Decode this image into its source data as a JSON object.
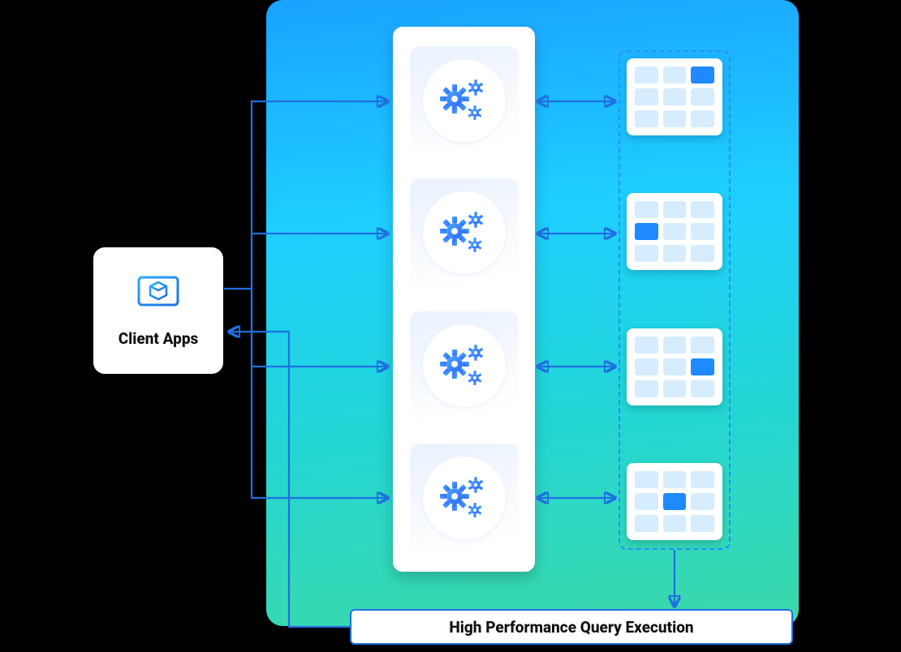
{
  "client": {
    "label": "Client Apps",
    "icon": "box-monitor-icon"
  },
  "gears_count": 4,
  "tables": {
    "count": 4,
    "highlight_index": [
      2,
      3,
      5,
      4
    ]
  },
  "query": {
    "label": "High Performance Query Execution"
  },
  "colors": {
    "accent": "#1f6fe0",
    "cell_light": "#d6ecff",
    "cell_dark": "#1f8aff"
  }
}
